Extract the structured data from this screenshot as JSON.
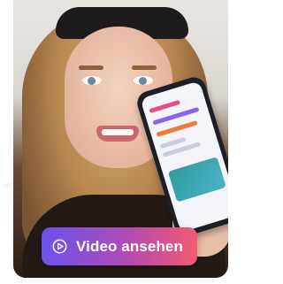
{
  "video_card": {
    "button_label": "Video ansehen",
    "button_icon": "play-circle-icon",
    "colors": {
      "button_gradient_start": "#6a52ee",
      "button_gradient_mid": "#b14bb5",
      "button_gradient_end": "#f25a6f",
      "button_text": "#ffffff"
    }
  }
}
